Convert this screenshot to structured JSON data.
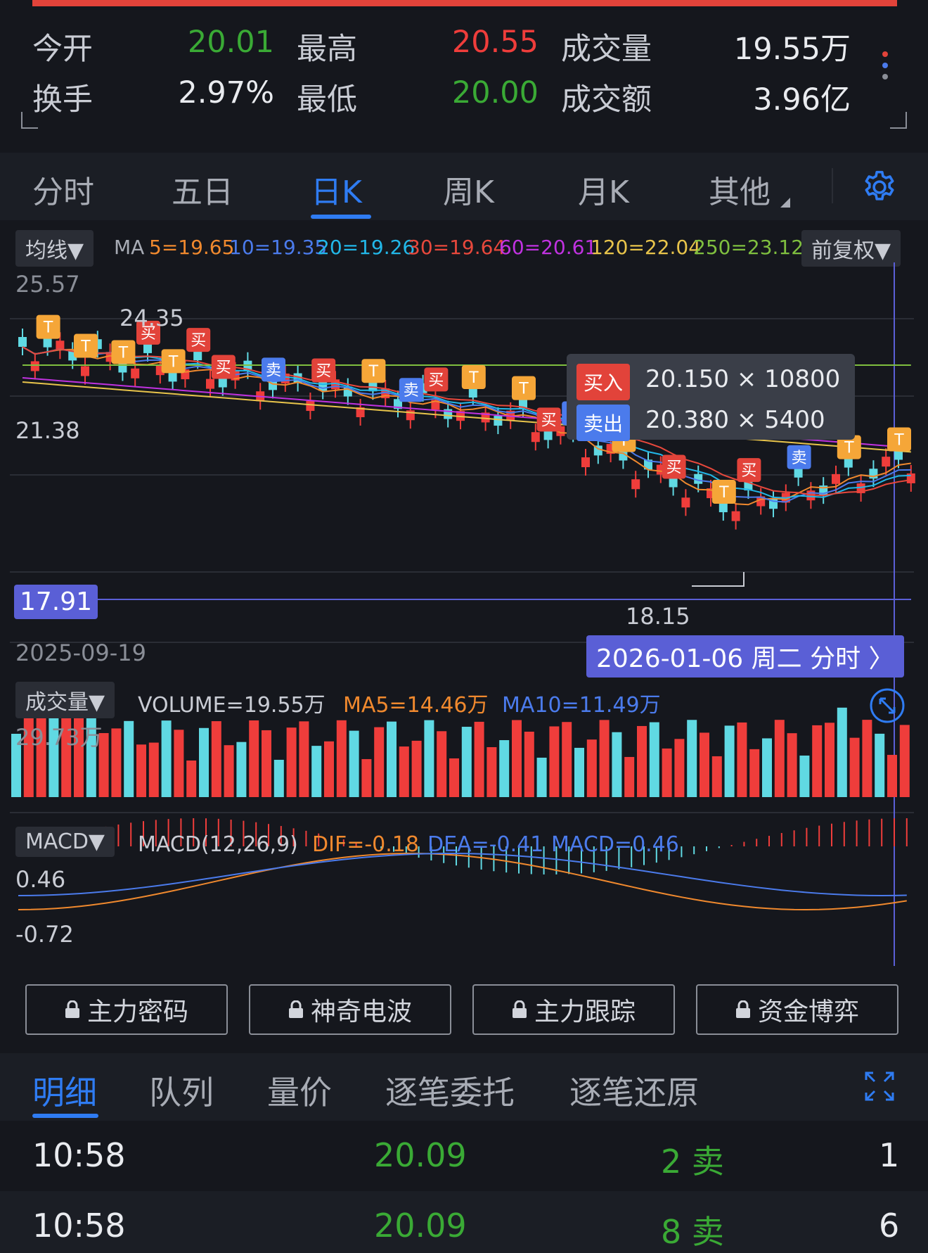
{
  "quote": {
    "open_label": "今开",
    "open_value": "20.01",
    "high_label": "最高",
    "high_value": "20.55",
    "volume_label": "成交量",
    "volume_value": "19.55万",
    "turnover_label": "换手",
    "turnover_value": "2.97%",
    "low_label": "最低",
    "low_value": "20.00",
    "amount_label": "成交额",
    "amount_value": "3.96亿"
  },
  "period_tabs": [
    "分时",
    "五日",
    "日K",
    "周K",
    "月K",
    "其他"
  ],
  "active_period": "日K",
  "kline": {
    "ma_chip": "均线▼",
    "ma_prefix": "MA",
    "ma_values": [
      {
        "label": "5=19.65",
        "color": "#f0892e"
      },
      {
        "label": "10=19.35",
        "color": "#4b7bec"
      },
      {
        "label": "20=19.26",
        "color": "#22b7e8"
      },
      {
        "label": "30=19.64",
        "color": "#e8483c"
      },
      {
        "label": "60=20.61",
        "color": "#c032e0"
      },
      {
        "label": "120=22.04",
        "color": "#e8c44b"
      },
      {
        "label": "250=23.12",
        "color": "#7fbf3f"
      }
    ],
    "adjust_chip": "前复权▼",
    "y_labels": [
      "25.57",
      "24.35",
      "21.38",
      "17.91"
    ],
    "low_marker": "18.15",
    "start_date": "2025-09-19",
    "crosshair_date": "2026-01-06 周二 分时 〉",
    "crosshair_price": "17.91",
    "tooltip": {
      "buy_tag": "买入",
      "buy_text": "20.150 × 10800",
      "sell_tag": "卖出",
      "sell_text": "20.380 × 5400"
    },
    "marker_text": {
      "t": "T",
      "buy": "买",
      "sell": "卖"
    }
  },
  "volume": {
    "chip": "成交量▼",
    "main": "VOLUME=19.55万",
    "ma5": "MA5=14.46万",
    "ma10": "MA10=11.49万",
    "y_label": "29.73万"
  },
  "macd": {
    "chip": "MACD▼",
    "params": "MACD(12,26,9)",
    "dif": "DIF=-0.18",
    "dea": "DEA=-0.41",
    "macd": "MACD=0.46",
    "y_top": "0.46",
    "y_bottom": "-0.72"
  },
  "tool_buttons": [
    "主力密码",
    "神奇电波",
    "主力跟踪",
    "资金博弈"
  ],
  "detail_tabs": [
    "明细",
    "队列",
    "量价",
    "逐笔委托",
    "逐笔还原"
  ],
  "trades": [
    {
      "time": "10:58",
      "price": "20.09",
      "volume": "2 卖",
      "count": "1"
    },
    {
      "time": "10:58",
      "price": "20.09",
      "volume": "8 卖",
      "count": "6"
    }
  ],
  "colors": {
    "up": "#ef3d3b",
    "down": "#60d9e3",
    "accent": "#2f7cf3",
    "marker_t": "#f5a638",
    "marker_buy": "#e2433a",
    "marker_sell": "#4b7bec"
  }
}
